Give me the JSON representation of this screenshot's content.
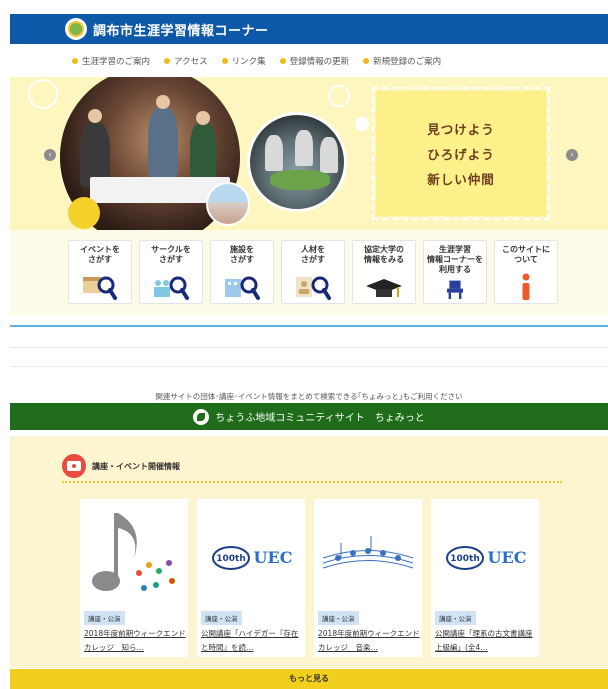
{
  "header": {
    "title": "調布市生涯学習情報コーナー"
  },
  "nav": {
    "items": [
      {
        "label": "生涯学習のご案内"
      },
      {
        "label": "アクセス"
      },
      {
        "label": "リンク集"
      },
      {
        "label": "登録情報の更新"
      },
      {
        "label": "新規登録のご案内"
      }
    ]
  },
  "hero": {
    "slogan": [
      "見つけよう",
      "ひろげよう",
      "新しい仲間"
    ],
    "prev_glyph": "‹",
    "next_glyph": "›"
  },
  "categories": [
    {
      "line1": "イベントを",
      "line2": "さがす",
      "icon": "calendar-search-icon"
    },
    {
      "line1": "サークルを",
      "line2": "さがす",
      "icon": "people-search-icon"
    },
    {
      "line1": "施設を",
      "line2": "さがす",
      "icon": "building-search-icon"
    },
    {
      "line1": "人材を",
      "line2": "さがす",
      "icon": "person-search-icon"
    },
    {
      "line1": "協定大学の",
      "line2": "情報をみる",
      "icon": "graduation-cap-icon"
    },
    {
      "line1": "生涯学習",
      "line2": "情報コーナーを",
      "line3": "利用する",
      "icon": "chair-icon"
    },
    {
      "line1": "このサイトに",
      "line2": "ついて",
      "icon": "info-icon"
    }
  ],
  "related": {
    "text": "関連サイトの団体･講座･イベント情報をまとめて検索できる｢ちょみっと｣もご利用ください",
    "banner": "ちょうふ地域コミュニティサイト　ちょみっと"
  },
  "events": {
    "title": "講座・イベント開催情報",
    "cards": [
      {
        "tag": "講座・公演",
        "title": "2018年度前期ウィークエンドカレッジ　知ら…",
        "image": "music-notes"
      },
      {
        "tag": "講座・公演",
        "title": "公開講座「ハイデガー『存在と時間』を読…",
        "image": "uec-100th"
      },
      {
        "tag": "講座・公演",
        "title": "2018年度前期ウィークエンドカレッジ　音楽…",
        "image": "score-notes"
      },
      {
        "tag": "講座・公演",
        "title": "公開講座「理系の古文書講座上級編」(全4…",
        "image": "uec-100th"
      }
    ],
    "more": "もっと見る"
  },
  "colors": {
    "header": "#0e58a8",
    "accent_yellow": "#f3cf1d",
    "community_green": "#1f6d1a",
    "hero_bg": "#fdf6bf",
    "divider_blue": "#5bb3e4"
  }
}
